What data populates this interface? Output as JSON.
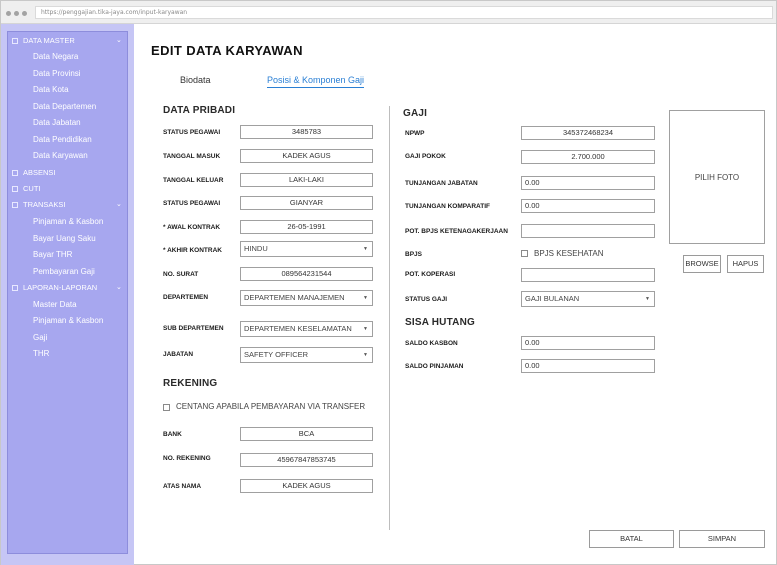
{
  "browser": {
    "url": "https://penggajian.tika-jaya.com/input-karyawan"
  },
  "sidebar": {
    "sections": [
      {
        "label": "DATA MASTER",
        "items": [
          "Data Negara",
          "Data Provinsi",
          "Data Kota",
          "Data Departemen",
          "Data Jabatan",
          "Data Pendidikan",
          "Data Karyawan"
        ]
      },
      {
        "label": "ABSENSI",
        "items": []
      },
      {
        "label": "CUTI",
        "items": []
      },
      {
        "label": "TRANSAKSI",
        "items": [
          "Pinjaman & Kasbon",
          "Bayar Uang Saku",
          "Bayar THR",
          "Pembayaran Gaji"
        ]
      },
      {
        "label": "LAPORAN-LAPORAN",
        "items": [
          "Master Data",
          "Pinjaman & Kasbon",
          "Gaji",
          "THR"
        ]
      }
    ]
  },
  "page": {
    "title": "EDIT DATA KARYAWAN"
  },
  "tabs": [
    {
      "label": "Biodata",
      "active": false
    },
    {
      "label": "Posisi & Komponen Gaji",
      "active": true
    }
  ],
  "pribadi": {
    "heading": "DATA PRIBADI",
    "status_pegawai": {
      "label": "STATUS PEGAWAI",
      "value": "3485783"
    },
    "tanggal_masuk": {
      "label": "TANGGAL MASUK",
      "value": "KADEK AGUS"
    },
    "tanggal_keluar": {
      "label": "TANGGAL KELUAR",
      "value": "LAKI-LAKI"
    },
    "status_pegawai2": {
      "label": "STATUS PEGAWAI",
      "value": "GIANYAR"
    },
    "awal_kontrak": {
      "label": "* AWAL KONTRAK",
      "value": "26-05-1991"
    },
    "akhir_kontrak": {
      "label": "* AKHIR KONTRAK",
      "value": "HINDU"
    },
    "no_surat": {
      "label": "NO. SURAT",
      "value": "089564231544"
    },
    "departemen": {
      "label": "DEPARTEMEN",
      "value": "DEPARTEMEN MANAJEMEN"
    },
    "sub_departemen": {
      "label": "SUB DEPARTEMEN",
      "value": "DEPARTEMEN KESELAMATAN"
    },
    "jabatan": {
      "label": "JABATAN",
      "value": "SAFETY OFFICER"
    }
  },
  "rekening": {
    "heading": "REKENING",
    "transfer_checkbox": "CENTANG APABILA PEMBAYARAN VIA TRANSFER",
    "bank": {
      "label": "BANK",
      "value": "BCA"
    },
    "no_rekening": {
      "label": "NO. REKENING",
      "value": "45967847853745"
    },
    "atas_nama": {
      "label": "ATAS NAMA",
      "value": "KADEK AGUS"
    }
  },
  "gaji": {
    "heading": "GAJI",
    "npwp": {
      "label": "NPWP",
      "value": "345372468234"
    },
    "gaji_pokok": {
      "label": "GAJI POKOK",
      "value": "2.700.000"
    },
    "tunjangan_jabatan": {
      "label": "TUNJANGAN JABATAN",
      "value": "0.00"
    },
    "tunjangan_komparatif": {
      "label": "TUNJANGAN KOMPARATIF",
      "value": "0.00"
    },
    "pot_bpjs": {
      "label": "POT. BPJS KETENAGAKERJAAN",
      "value": ""
    },
    "bpjs": {
      "label": "BPJS",
      "checkbox": "BPJS KESEHATAN"
    },
    "pot_koperasi": {
      "label": "POT. KOPERASI",
      "value": ""
    },
    "status_gaji": {
      "label": "STATUS GAJI",
      "value": "GAJI BULANAN"
    }
  },
  "hutang": {
    "heading": "SISA HUTANG",
    "saldo_kasbon": {
      "label": "SALDO KASBON",
      "value": "0.00"
    },
    "saldo_pinjaman": {
      "label": "SALDO PINJAMAN",
      "value": "0.00"
    }
  },
  "photo": {
    "placeholder": "PILIH FOTO",
    "browse": "BROWSE",
    "hapus": "HAPUS"
  },
  "actions": {
    "batal": "BATAL",
    "simpan": "SIMPAN"
  },
  "colors": {
    "sidebar_bg": "#c6c6f5",
    "sidebar_panel": "#a7a7ef",
    "tab_active": "#2a7fd4"
  }
}
